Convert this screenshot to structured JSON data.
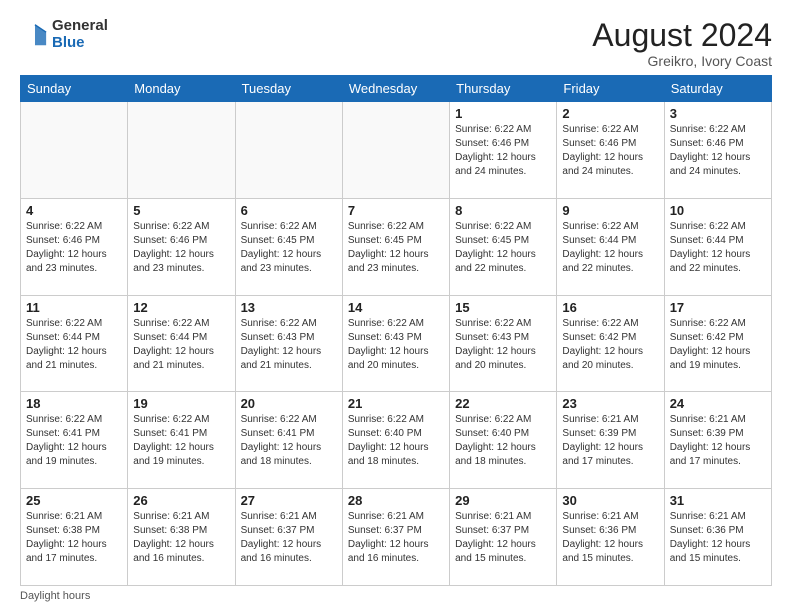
{
  "logo": {
    "general": "General",
    "blue": "Blue"
  },
  "header": {
    "month": "August 2024",
    "location": "Greikro, Ivory Coast"
  },
  "weekdays": [
    "Sunday",
    "Monday",
    "Tuesday",
    "Wednesday",
    "Thursday",
    "Friday",
    "Saturday"
  ],
  "weeks": [
    [
      {
        "day": "",
        "empty": true
      },
      {
        "day": "",
        "empty": true
      },
      {
        "day": "",
        "empty": true
      },
      {
        "day": "",
        "empty": true
      },
      {
        "day": "1",
        "sunrise": "6:22 AM",
        "sunset": "6:46 PM",
        "daylight": "12 hours and 24 minutes."
      },
      {
        "day": "2",
        "sunrise": "6:22 AM",
        "sunset": "6:46 PM",
        "daylight": "12 hours and 24 minutes."
      },
      {
        "day": "3",
        "sunrise": "6:22 AM",
        "sunset": "6:46 PM",
        "daylight": "12 hours and 24 minutes."
      }
    ],
    [
      {
        "day": "4",
        "sunrise": "6:22 AM",
        "sunset": "6:46 PM",
        "daylight": "12 hours and 23 minutes."
      },
      {
        "day": "5",
        "sunrise": "6:22 AM",
        "sunset": "6:46 PM",
        "daylight": "12 hours and 23 minutes."
      },
      {
        "day": "6",
        "sunrise": "6:22 AM",
        "sunset": "6:45 PM",
        "daylight": "12 hours and 23 minutes."
      },
      {
        "day": "7",
        "sunrise": "6:22 AM",
        "sunset": "6:45 PM",
        "daylight": "12 hours and 23 minutes."
      },
      {
        "day": "8",
        "sunrise": "6:22 AM",
        "sunset": "6:45 PM",
        "daylight": "12 hours and 22 minutes."
      },
      {
        "day": "9",
        "sunrise": "6:22 AM",
        "sunset": "6:44 PM",
        "daylight": "12 hours and 22 minutes."
      },
      {
        "day": "10",
        "sunrise": "6:22 AM",
        "sunset": "6:44 PM",
        "daylight": "12 hours and 22 minutes."
      }
    ],
    [
      {
        "day": "11",
        "sunrise": "6:22 AM",
        "sunset": "6:44 PM",
        "daylight": "12 hours and 21 minutes."
      },
      {
        "day": "12",
        "sunrise": "6:22 AM",
        "sunset": "6:44 PM",
        "daylight": "12 hours and 21 minutes."
      },
      {
        "day": "13",
        "sunrise": "6:22 AM",
        "sunset": "6:43 PM",
        "daylight": "12 hours and 21 minutes."
      },
      {
        "day": "14",
        "sunrise": "6:22 AM",
        "sunset": "6:43 PM",
        "daylight": "12 hours and 20 minutes."
      },
      {
        "day": "15",
        "sunrise": "6:22 AM",
        "sunset": "6:43 PM",
        "daylight": "12 hours and 20 minutes."
      },
      {
        "day": "16",
        "sunrise": "6:22 AM",
        "sunset": "6:42 PM",
        "daylight": "12 hours and 20 minutes."
      },
      {
        "day": "17",
        "sunrise": "6:22 AM",
        "sunset": "6:42 PM",
        "daylight": "12 hours and 19 minutes."
      }
    ],
    [
      {
        "day": "18",
        "sunrise": "6:22 AM",
        "sunset": "6:41 PM",
        "daylight": "12 hours and 19 minutes."
      },
      {
        "day": "19",
        "sunrise": "6:22 AM",
        "sunset": "6:41 PM",
        "daylight": "12 hours and 19 minutes."
      },
      {
        "day": "20",
        "sunrise": "6:22 AM",
        "sunset": "6:41 PM",
        "daylight": "12 hours and 18 minutes."
      },
      {
        "day": "21",
        "sunrise": "6:22 AM",
        "sunset": "6:40 PM",
        "daylight": "12 hours and 18 minutes."
      },
      {
        "day": "22",
        "sunrise": "6:22 AM",
        "sunset": "6:40 PM",
        "daylight": "12 hours and 18 minutes."
      },
      {
        "day": "23",
        "sunrise": "6:21 AM",
        "sunset": "6:39 PM",
        "daylight": "12 hours and 17 minutes."
      },
      {
        "day": "24",
        "sunrise": "6:21 AM",
        "sunset": "6:39 PM",
        "daylight": "12 hours and 17 minutes."
      }
    ],
    [
      {
        "day": "25",
        "sunrise": "6:21 AM",
        "sunset": "6:38 PM",
        "daylight": "12 hours and 17 minutes."
      },
      {
        "day": "26",
        "sunrise": "6:21 AM",
        "sunset": "6:38 PM",
        "daylight": "12 hours and 16 minutes."
      },
      {
        "day": "27",
        "sunrise": "6:21 AM",
        "sunset": "6:37 PM",
        "daylight": "12 hours and 16 minutes."
      },
      {
        "day": "28",
        "sunrise": "6:21 AM",
        "sunset": "6:37 PM",
        "daylight": "12 hours and 16 minutes."
      },
      {
        "day": "29",
        "sunrise": "6:21 AM",
        "sunset": "6:37 PM",
        "daylight": "12 hours and 15 minutes."
      },
      {
        "day": "30",
        "sunrise": "6:21 AM",
        "sunset": "6:36 PM",
        "daylight": "12 hours and 15 minutes."
      },
      {
        "day": "31",
        "sunrise": "6:21 AM",
        "sunset": "6:36 PM",
        "daylight": "12 hours and 15 minutes."
      }
    ]
  ],
  "footer": {
    "daylight_label": "Daylight hours"
  }
}
